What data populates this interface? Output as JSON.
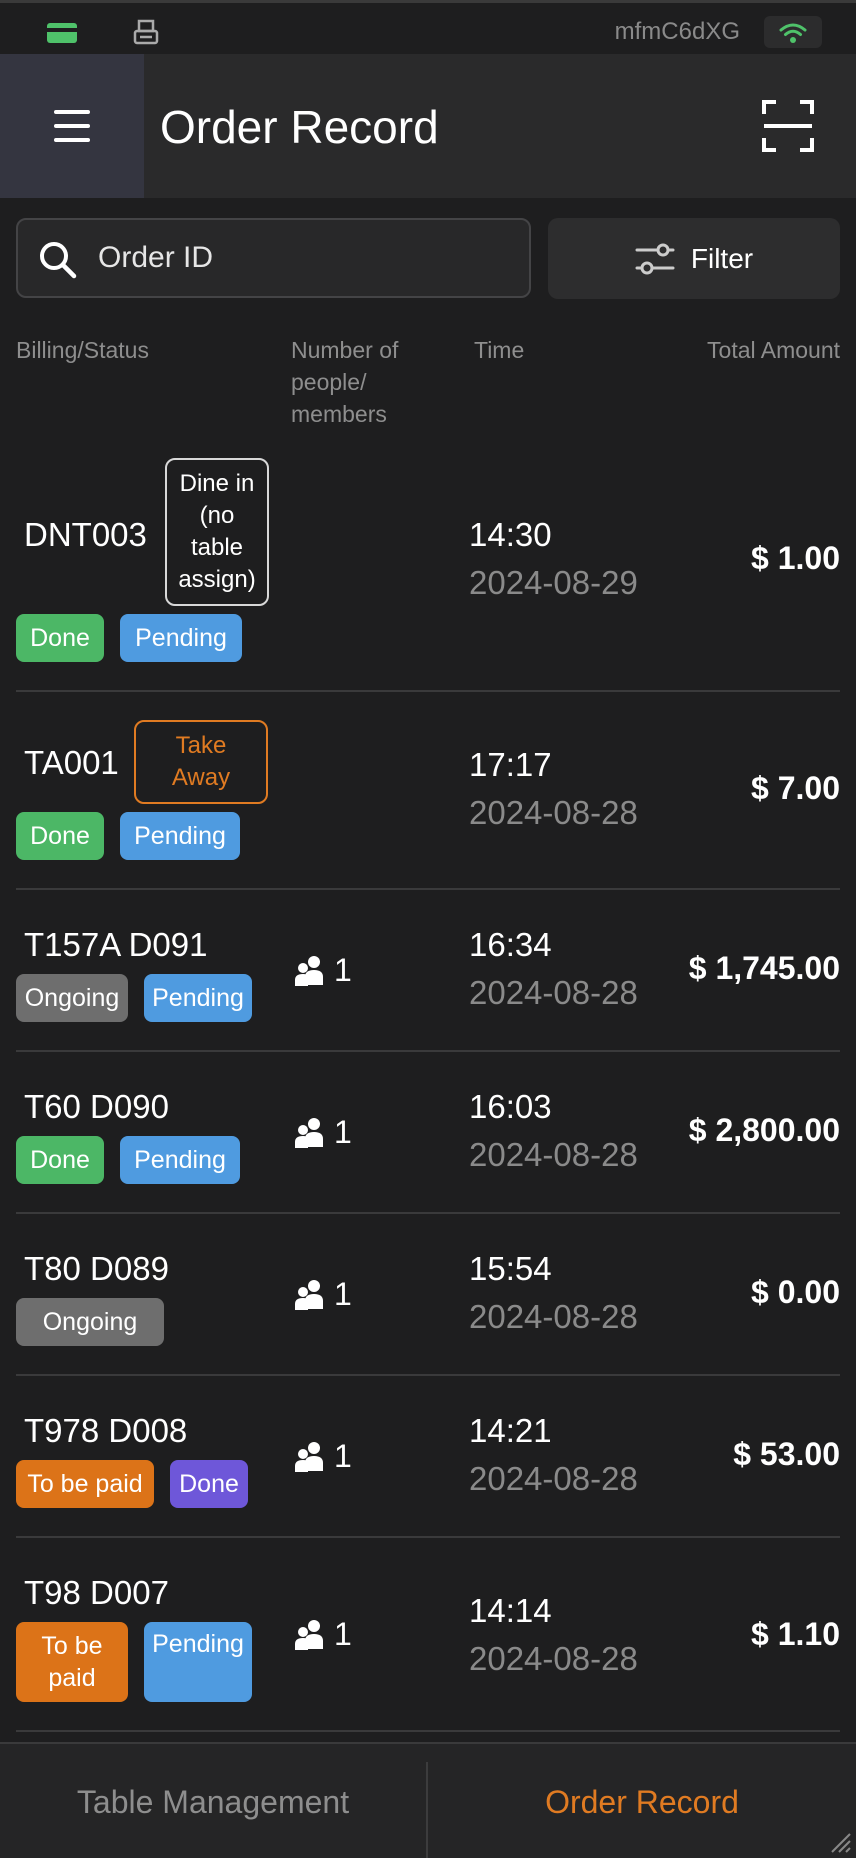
{
  "status_bar": {
    "device_id": "mfmC6dXG",
    "icons": [
      "card-icon",
      "printer-icon",
      "wifi-icon"
    ],
    "wifi_color": "#4fc26a"
  },
  "header": {
    "title": "Order Record",
    "icons": [
      "menu-icon",
      "scan-icon"
    ]
  },
  "search": {
    "placeholder": "Order ID",
    "value": ""
  },
  "filter": {
    "label": "Filter"
  },
  "columns": {
    "billing_status": "Billing/Status",
    "people": "Number of people/ members",
    "people_lines": [
      "Number of",
      "people/",
      "members"
    ],
    "time": "Time",
    "total": "Total Amount"
  },
  "orders": [
    {
      "id": "DNT003",
      "type_badge": "Dine in (no table assign)",
      "type_lines": [
        "Dine in",
        "(no",
        "table",
        "assign)"
      ],
      "statuses": [
        "Done",
        "Pending"
      ],
      "people": "",
      "time": "14:30",
      "date": "2024-08-29",
      "amount": "$ 1.00"
    },
    {
      "id": "TA001",
      "type_badge": "Take Away",
      "type_lines": [
        "Take",
        "Away"
      ],
      "statuses": [
        "Done",
        "Pending"
      ],
      "people": "",
      "time": "17:17",
      "date": "2024-08-28",
      "amount": "$ 7.00"
    },
    {
      "id": "T157A  D091",
      "statuses": [
        "Ongoing",
        "Pending"
      ],
      "people": "1",
      "time": "16:34",
      "date": "2024-08-28",
      "amount": "$ 1,745.00"
    },
    {
      "id": "T60  D090",
      "statuses": [
        "Done",
        "Pending"
      ],
      "people": "1",
      "time": "16:03",
      "date": "2024-08-28",
      "amount": "$ 2,800.00"
    },
    {
      "id": "T80  D089",
      "statuses": [
        "Ongoing"
      ],
      "people": "1",
      "time": "15:54",
      "date": "2024-08-28",
      "amount": "$ 0.00"
    },
    {
      "id": "T978  D008",
      "statuses": [
        "To be paid",
        "Done"
      ],
      "people": "1",
      "time": "14:21",
      "date": "2024-08-28",
      "amount": "$ 53.00"
    },
    {
      "id": "T98  D007",
      "statuses": [
        "To be paid",
        "Pending"
      ],
      "people": "1",
      "time": "14:14",
      "date": "2024-08-28",
      "amount": "$ 1.10"
    }
  ],
  "colors": {
    "done": "#4cb766",
    "pending": "#4f9be0",
    "ongoing": "#6e6e6e",
    "to_be_paid": "#dc7318",
    "done_purple": "#6e57d9",
    "take_away": "#e07b22",
    "active_tab": "#e07b22"
  },
  "tabs": {
    "table_management": "Table Management",
    "order_record": "Order Record",
    "active": "order_record"
  }
}
